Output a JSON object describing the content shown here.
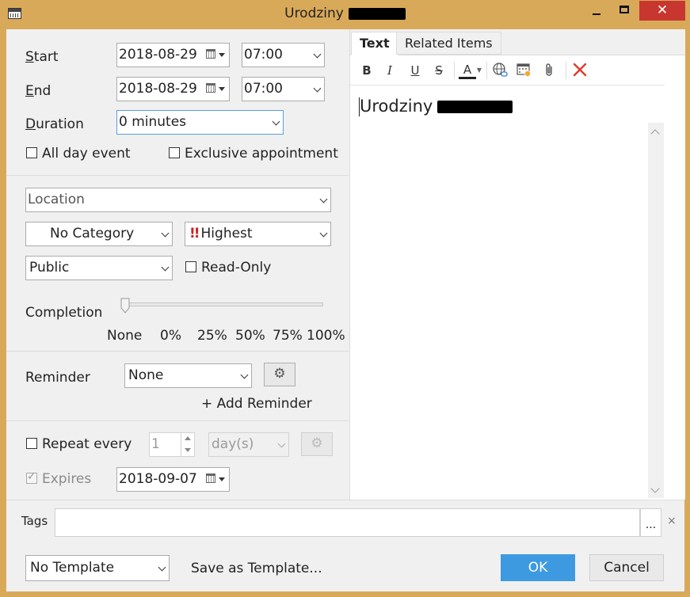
{
  "window": {
    "title": "Urodziny",
    "controls": {
      "minimize": "",
      "maximize": "",
      "close": "✕"
    }
  },
  "schedule": {
    "start_label_first": "S",
    "start_label_rest": "tart",
    "start_date": "2018-08-29",
    "start_time": "07:00",
    "end_label_first": "E",
    "end_label_rest": "nd",
    "end_date": "2018-08-29",
    "end_time": "07:00",
    "duration_label_first": "D",
    "duration_label_rest": "uration",
    "duration_value": "0 minutes",
    "all_day_label": "All day event",
    "exclusive_label": "Exclusive appointment"
  },
  "details": {
    "location_placeholder": "Location",
    "category": "No Category",
    "priority_icon": "!!",
    "priority": "Highest",
    "visibility": "Public",
    "readonly_label": "Read-Only",
    "completion_label": "Completion",
    "completion_value": 0,
    "completion_ticks": [
      "None",
      "0%",
      "25%",
      "50%",
      "75%",
      "100%"
    ]
  },
  "reminder": {
    "label": "Reminder",
    "value": "None",
    "add_label": "+ Add Reminder"
  },
  "recurrence": {
    "repeat_label": "Repeat every",
    "interval": "1",
    "unit": "day(s)",
    "expires_label": "Expires",
    "expires_date": "2018-09-07"
  },
  "editor": {
    "tabs": [
      "Text",
      "Related Items"
    ],
    "toolbar": {
      "bold": "B",
      "italic": "I",
      "underline": "U",
      "strike": "S",
      "font_color": "A"
    },
    "content_title": "Urodziny"
  },
  "tags": {
    "label": "Tags",
    "more": "...",
    "clear": "×"
  },
  "footer": {
    "template": "No Template",
    "save_template": "Save as Template...",
    "ok": "OK",
    "cancel": "Cancel"
  }
}
